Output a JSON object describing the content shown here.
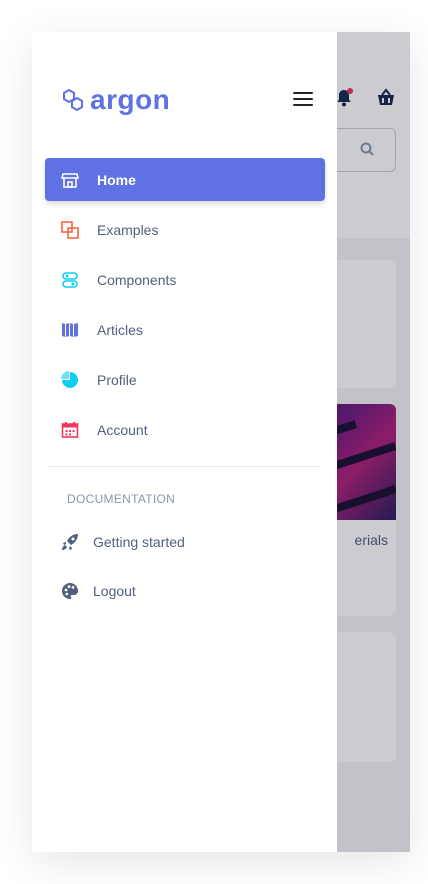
{
  "brand": {
    "name": "argon"
  },
  "nav": {
    "items": [
      {
        "label": "Home",
        "icon": "shop-icon"
      },
      {
        "label": "Examples",
        "icon": "ungroup-icon"
      },
      {
        "label": "Components",
        "icon": "components-icon"
      },
      {
        "label": "Articles",
        "icon": "spaceship-icon"
      },
      {
        "label": "Profile",
        "icon": "chart-pie-icon"
      },
      {
        "label": "Account",
        "icon": "calendar-icon"
      }
    ]
  },
  "documentation": {
    "heading": "DOCUMENTATION",
    "items": [
      {
        "label": "Getting started",
        "icon": "rocket-icon"
      },
      {
        "label": "Logout",
        "icon": "palette-icon"
      }
    ]
  },
  "background": {
    "card_text": "erials"
  },
  "colors": {
    "primary": "#5e72e4",
    "text": "#525f7f",
    "muted": "#8898aa",
    "examples_icon": "#fb6340",
    "components_icon": "#11cdef",
    "account_icon": "#f5365c",
    "notification": "#f5365c"
  }
}
